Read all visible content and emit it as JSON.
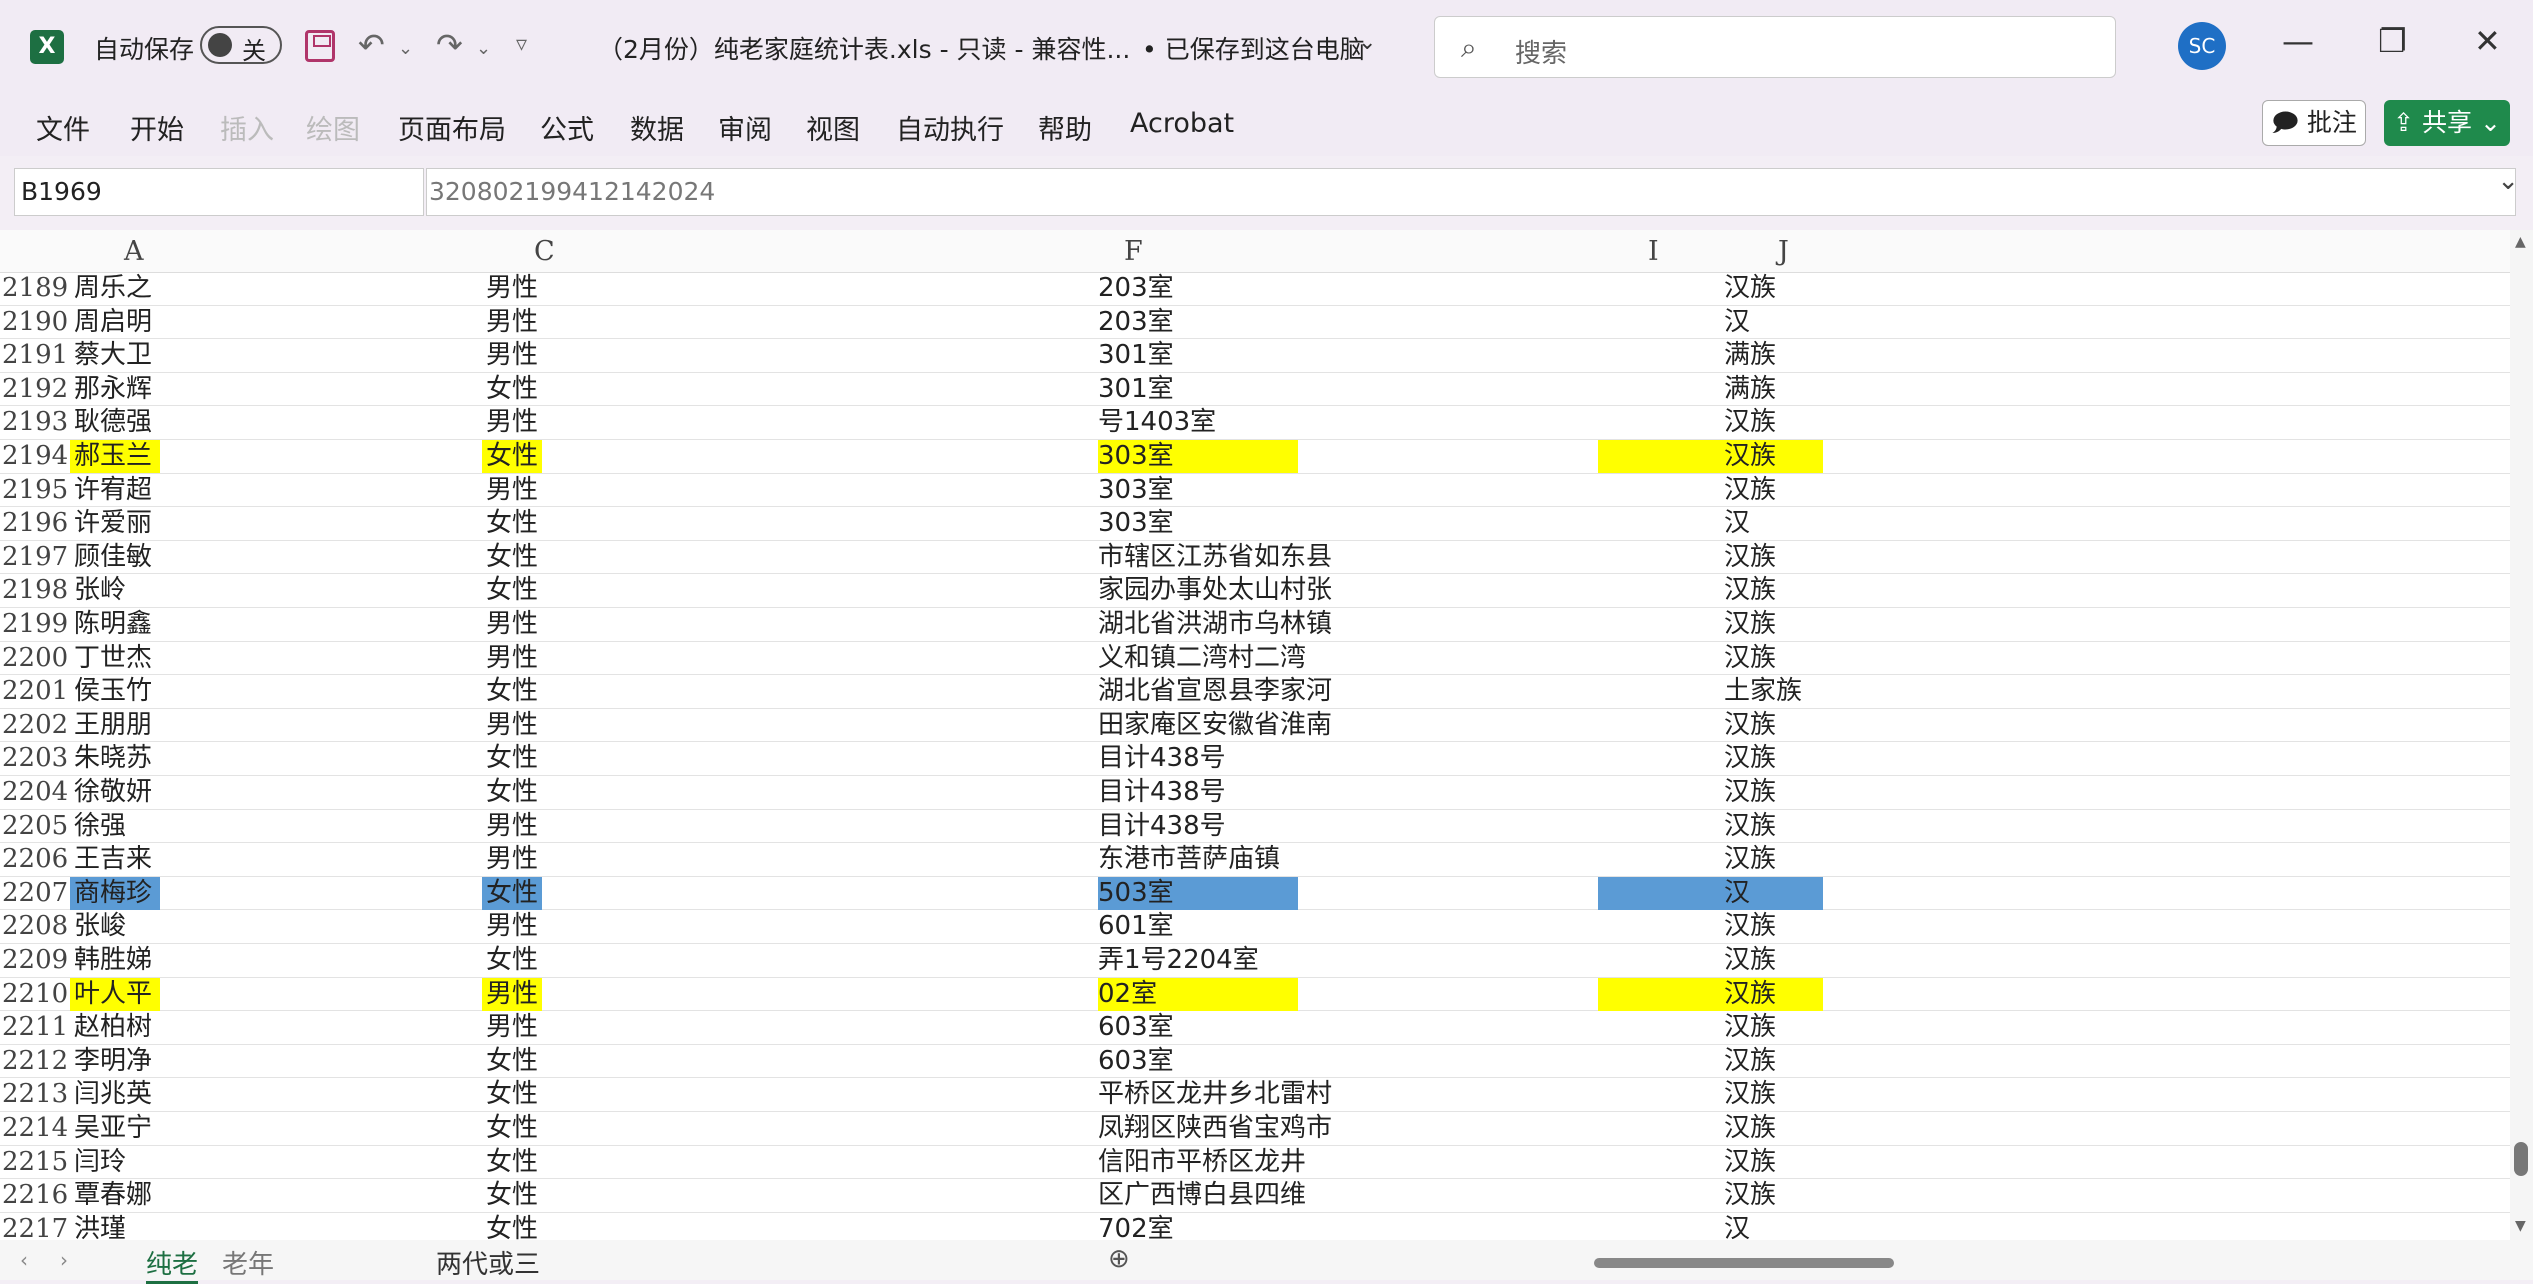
{
  "titlebar": {
    "app_icon": "X",
    "autosave_label": "自动保存",
    "autosave_state": "关",
    "document_title": "（2月份）纯老家庭统计表.xls  -  只读  -  兼容性...",
    "saved_state": "• 已保存到这台电脑",
    "search_placeholder": "搜索",
    "user_initials": "SC"
  },
  "ribbon": {
    "tabs": [
      "文件",
      "开始",
      "插入",
      "绘图",
      "页面布局",
      "公式",
      "数据",
      "审阅",
      "视图",
      "自动执行",
      "帮助",
      "Acrobat"
    ],
    "comment_label": "批注",
    "share_label": "共享"
  },
  "formula_bar": {
    "name_box": "B1969",
    "formula": "320802199412142024"
  },
  "columns": [
    "A",
    "C",
    "F",
    "I",
    "J"
  ],
  "rows": [
    {
      "num": "2189",
      "name": "周乐之",
      "gender": "男性",
      "address": "203室",
      "ethnicity": "汉族"
    },
    {
      "num": "2190",
      "name": "周启明",
      "gender": "男性",
      "address": "203室",
      "ethnicity": "汉"
    },
    {
      "num": "2191",
      "name": "蔡大卫",
      "gender": "男性",
      "address": "301室",
      "ethnicity": "满族"
    },
    {
      "num": "2192",
      "name": "那永辉",
      "gender": "女性",
      "address": "301室",
      "ethnicity": "满族"
    },
    {
      "num": "2193",
      "name": "耿德强",
      "gender": "男性",
      "address": "号1403室",
      "ethnicity": "汉族"
    },
    {
      "num": "2194",
      "name": "郝玉兰",
      "gender": "女性",
      "address": "303室",
      "ethnicity": "汉族",
      "highlight": "yellow"
    },
    {
      "num": "2195",
      "name": "许宥超",
      "gender": "男性",
      "address": "303室",
      "ethnicity": "汉族"
    },
    {
      "num": "2196",
      "name": "许爱丽",
      "gender": "女性",
      "address": "303室",
      "ethnicity": "汉"
    },
    {
      "num": "2197",
      "name": "顾佳敏",
      "gender": "女性",
      "address": "市辖区江苏省如东县",
      "ethnicity": "汉族"
    },
    {
      "num": "2198",
      "name": "张岭",
      "gender": "女性",
      "address": "家园办事处太山村张",
      "ethnicity": "汉族"
    },
    {
      "num": "2199",
      "name": "陈明鑫",
      "gender": "男性",
      "address": "湖北省洪湖市乌林镇",
      "ethnicity": "汉族"
    },
    {
      "num": "2200",
      "name": "丁世杰",
      "gender": "男性",
      "address": "义和镇二湾村二湾",
      "ethnicity": "汉族"
    },
    {
      "num": "2201",
      "name": "侯玉竹",
      "gender": "女性",
      "address": "湖北省宣恩县李家河",
      "ethnicity": "土家族"
    },
    {
      "num": "2202",
      "name": "王朋朋",
      "gender": "男性",
      "address": "田家庵区安徽省淮南",
      "ethnicity": "汉族"
    },
    {
      "num": "2203",
      "name": "朱晓苏",
      "gender": "女性",
      "address": "目计438号",
      "ethnicity": "汉族"
    },
    {
      "num": "2204",
      "name": "徐敬妍",
      "gender": "女性",
      "address": "目计438号",
      "ethnicity": "汉族"
    },
    {
      "num": "2205",
      "name": "徐强",
      "gender": "男性",
      "address": "目计438号",
      "ethnicity": "汉族"
    },
    {
      "num": "2206",
      "name": "王吉来",
      "gender": "男性",
      "address": "东港市菩萨庙镇",
      "ethnicity": "汉族"
    },
    {
      "num": "2207",
      "name": "商梅珍",
      "gender": "女性",
      "address": "503室",
      "ethnicity": "汉",
      "highlight": "blue"
    },
    {
      "num": "2208",
      "name": "张峻",
      "gender": "男性",
      "address": "601室",
      "ethnicity": "汉族"
    },
    {
      "num": "2209",
      "name": "韩胜娣",
      "gender": "女性",
      "address": "弄1号2204室",
      "ethnicity": "汉族"
    },
    {
      "num": "2210",
      "name": "叶人平",
      "gender": "男性",
      "address": "02室",
      "ethnicity": "汉族",
      "highlight": "yellow"
    },
    {
      "num": "2211",
      "name": "赵柏树",
      "gender": "男性",
      "address": "603室",
      "ethnicity": "汉族"
    },
    {
      "num": "2212",
      "name": "李明净",
      "gender": "女性",
      "address": "603室",
      "ethnicity": "汉族"
    },
    {
      "num": "2213",
      "name": "闫兆英",
      "gender": "女性",
      "address": "平桥区龙井乡北雷村",
      "ethnicity": "汉族"
    },
    {
      "num": "2214",
      "name": "吴亚宁",
      "gender": "女性",
      "address": "凤翔区陕西省宝鸡市",
      "ethnicity": "汉族"
    },
    {
      "num": "2215",
      "name": "闫玲",
      "gender": "女性",
      "address": "信阳市平桥区龙井",
      "ethnicity": "汉族"
    },
    {
      "num": "2216",
      "name": "覃春娜",
      "gender": "女性",
      "address": "区广西博白县四维",
      "ethnicity": "汉族"
    },
    {
      "num": "2217",
      "name": "洪瑾",
      "gender": "女性",
      "address": "702室",
      "ethnicity": "汉"
    }
  ],
  "sheet_tabs": [
    "纯老",
    "老年",
    "两代或三"
  ],
  "colors": {
    "excel_green": "#1d6f42",
    "share_green": "#1f8a4c",
    "avatar_blue": "#1f6fc5",
    "highlight_yellow": "#ffff00",
    "highlight_blue": "#5b9bd5"
  }
}
